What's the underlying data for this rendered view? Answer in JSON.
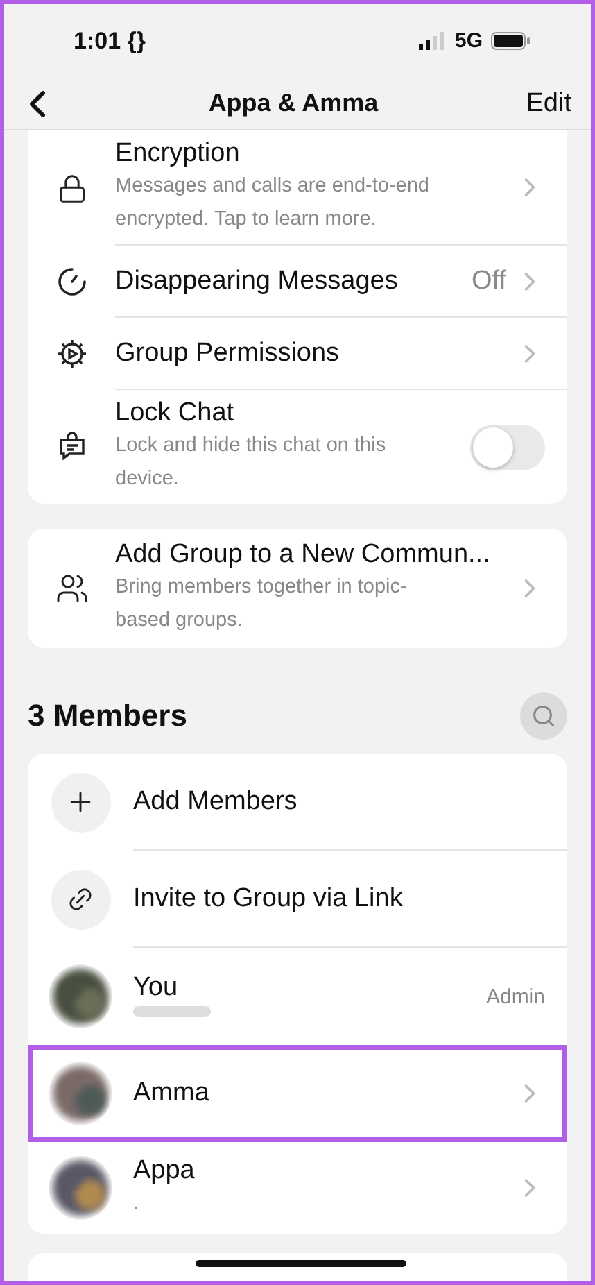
{
  "status_bar": {
    "time": "1:01 {}",
    "network": "5G"
  },
  "nav": {
    "title": "Appa & Amma",
    "action": "Edit"
  },
  "settings": [
    {
      "kind": "link",
      "title": "Encryption",
      "subtitle": "Messages and calls are end-to-end encrypted. Tap to learn more."
    },
    {
      "kind": "link",
      "title": "Disappearing Messages",
      "value": "Off"
    },
    {
      "kind": "link",
      "title": "Group Permissions"
    },
    {
      "kind": "toggle",
      "title": "Lock Chat",
      "subtitle": "Lock and hide this chat on this device.",
      "on": false
    }
  ],
  "community": {
    "title": "Add Group to a New Commun...",
    "subtitle": "Bring members together in topic-based groups."
  },
  "members_header": "3 Members",
  "actions": [
    {
      "label": "Add Members"
    },
    {
      "label": "Invite to Group via Link"
    }
  ],
  "members": [
    {
      "name": "You",
      "badge": "Admin",
      "highlighted": false,
      "chevron": false
    },
    {
      "name": "Amma",
      "highlighted": true,
      "chevron": true
    },
    {
      "name": "Appa",
      "subtitle": ".",
      "highlighted": false,
      "chevron": true
    }
  ]
}
